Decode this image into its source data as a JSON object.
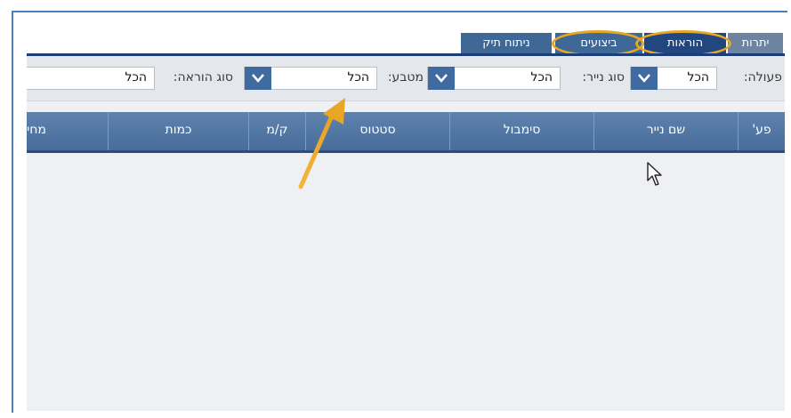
{
  "tabs": [
    {
      "label": "יתרות",
      "state": "default"
    },
    {
      "label": "הוראות",
      "state": "active"
    },
    {
      "label": "ביצועים",
      "state": "default"
    },
    {
      "label": "ניתוח תיק",
      "state": "default"
    }
  ],
  "filters": {
    "action": {
      "label": "פעולה:",
      "value": "הכל"
    },
    "paper_type": {
      "label": "סוג נייר:",
      "value": "הכל"
    },
    "currency": {
      "label": "מטבע:",
      "value": "הכל"
    },
    "order_type": {
      "label": "סוג הוראה:",
      "value": "הכל"
    }
  },
  "table": {
    "columns": [
      "פע'",
      "שם נייר",
      "סימבול",
      "סטטוס",
      "ק/מ",
      "כמות",
      "מחי"
    ]
  },
  "colors": {
    "accent_ring": "#e8a625",
    "header_bg": "#5a7fab",
    "tab_active": "#22467e",
    "frame_border": "#4a7fc0"
  },
  "annotations": {
    "highlight": "orange-ring-around-tabs",
    "arrow": "orange-arrow-to-currency-filter"
  }
}
